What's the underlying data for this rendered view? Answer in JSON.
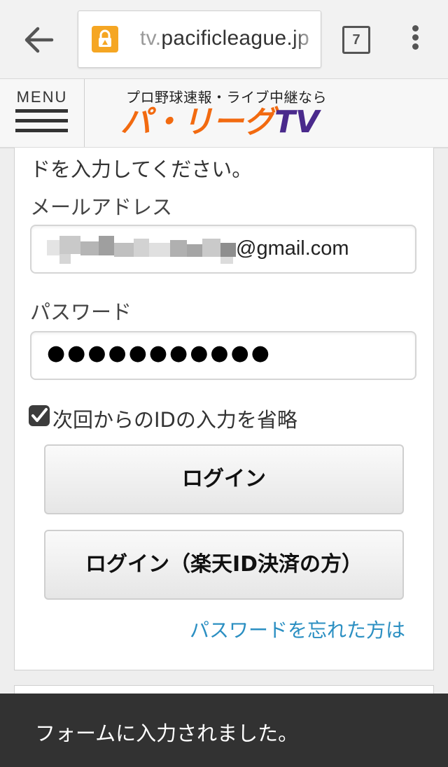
{
  "browser": {
    "url_prefix": "tv.",
    "url_domain": "pacificleague.jp",
    "tab_count": "7"
  },
  "site": {
    "menu_label": "MENU",
    "tagline": "プロ野球速報・ライブ中継なら",
    "logo_part1": "パ・リーグ",
    "logo_part2": "TV"
  },
  "form": {
    "intro_text": "ドを入力してください。",
    "email_label": "メールアドレス",
    "email_value_visible": "@gmail.com",
    "password_label": "パスワード",
    "password_value": "●●●●●●●●●●●",
    "remember_label": "次回からのIDの入力を省略",
    "remember_checked": true,
    "login_button": "ログイン",
    "login_rakuten_button": "ログイン（楽天ID決済の方）",
    "forgot_link": "パスワードを忘れた方は"
  },
  "toast": {
    "message": "フォームに入力されました。"
  },
  "colors": {
    "accent_link": "#2b8fc2",
    "logo_orange": "#f26a10",
    "logo_purple": "#4a2a8c",
    "lock_badge": "#f5a623",
    "toast_bg": "#323232"
  }
}
